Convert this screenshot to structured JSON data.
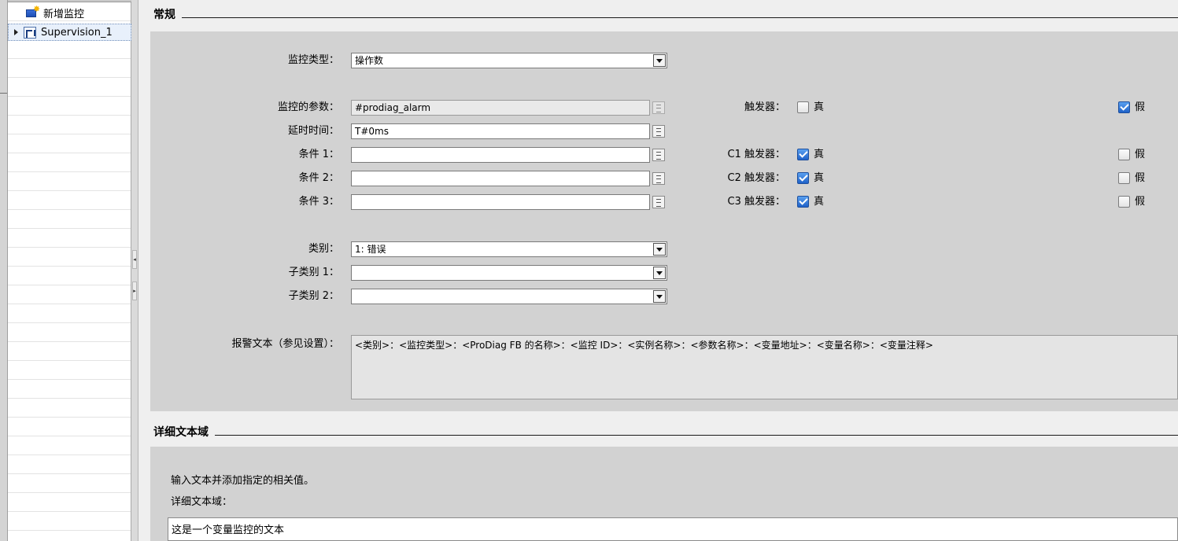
{
  "tree": {
    "add_label": "新增监控",
    "item_label": "Supervision_1"
  },
  "sections": {
    "general": "常规",
    "detail": "详细文本域"
  },
  "form": {
    "type_label": "监控类型：",
    "type_value": "操作数",
    "param_label": "监控的参数：",
    "param_value": "#prodiag_alarm",
    "delay_label": "延时时间：",
    "delay_value": "T#0ms",
    "cond1_label": "条件 1：",
    "cond1_value": "",
    "cond2_label": "条件 2：",
    "cond2_value": "",
    "cond3_label": "条件 3：",
    "cond3_value": "",
    "category_label": "类别：",
    "category_value": "1: 错误",
    "sub1_label": "子类别 1：",
    "sub1_value": "",
    "sub2_label": "子类别 2：",
    "sub2_value": "",
    "alarm_label": "报警文本（参见设置）：",
    "alarm_value": "<类别>：<监控类型>：<ProDiag FB 的名称>：<监控 ID>：<实例名称>：<参数名称>：<变量地址>：<变量名称>：<变量注释>"
  },
  "triggers": {
    "main_label": "触发器：",
    "c1_label": "C1 触发器：",
    "c2_label": "C2 触发器：",
    "c3_label": "C3 触发器：",
    "true_label": "真",
    "false_label": "假",
    "main_true": false,
    "main_false": true,
    "c1_true": true,
    "c1_false": false,
    "c2_true": true,
    "c2_false": false,
    "c3_true": true,
    "c3_false": false
  },
  "detail": {
    "hint": "输入文本并添加指定的相关值。",
    "label": "详细文本域：",
    "value": "这是一个变量监控的文本"
  }
}
